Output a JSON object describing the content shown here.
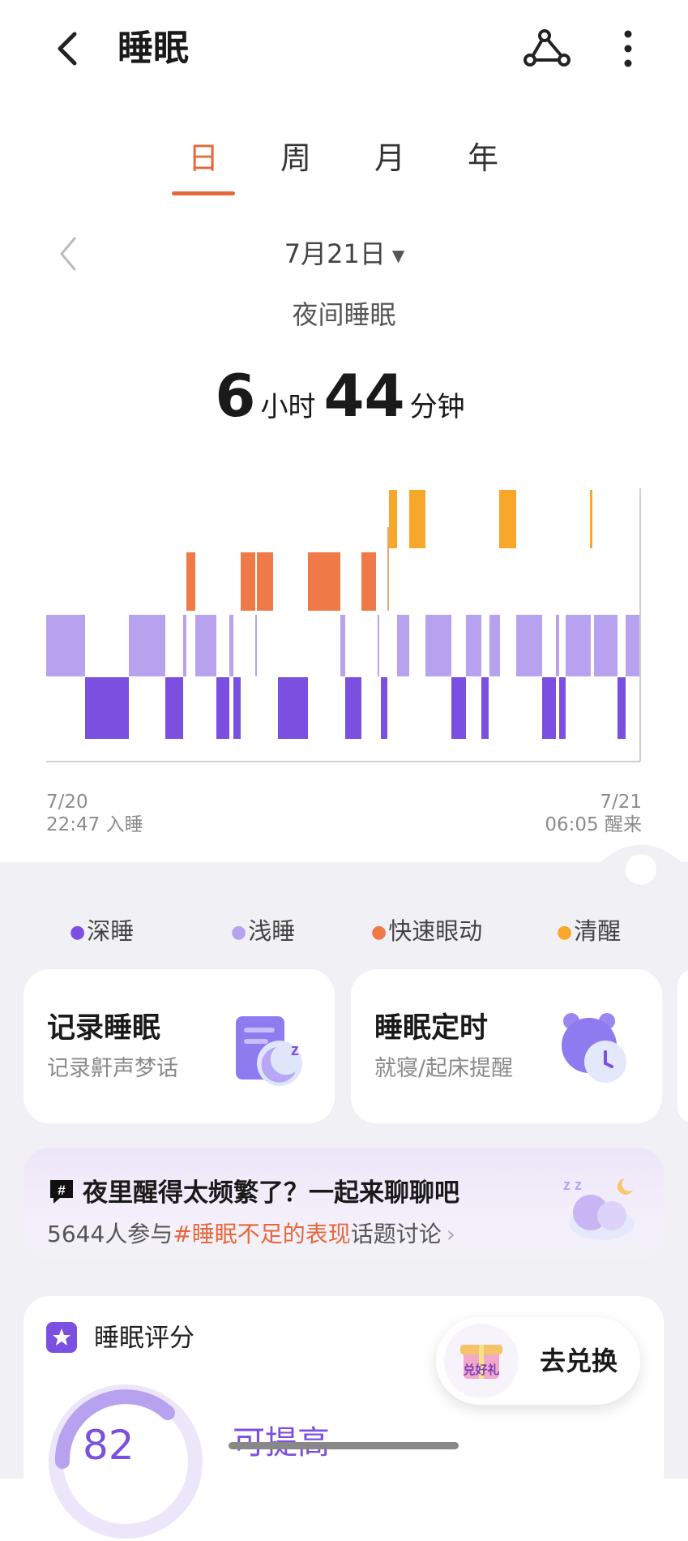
{
  "header": {
    "title": "睡眠"
  },
  "tabs": [
    "日",
    "周",
    "月",
    "年"
  ],
  "date": {
    "label": "7月21日"
  },
  "summary": {
    "section_label": "夜间睡眠",
    "hours": "6",
    "hours_unit": "小时",
    "minutes": "44",
    "minutes_unit": "分钟"
  },
  "timeline": {
    "start_date": "7/20",
    "start_time": "22:47 入睡",
    "end_date": "7/21",
    "end_time": "06:05 醒来"
  },
  "legend": [
    {
      "label": "深睡",
      "color": "#7b4fe0"
    },
    {
      "label": "浅睡",
      "color": "#b7a2f0"
    },
    {
      "label": "快速眼动",
      "color": "#f07a47"
    },
    {
      "label": "清醒",
      "color": "#f9a72b"
    }
  ],
  "cards": {
    "record": {
      "title": "记录睡眠",
      "subtitle": "记录鼾声梦话"
    },
    "timer": {
      "title": "睡眠定时",
      "subtitle": "就寝/起床提醒"
    }
  },
  "topic": {
    "title": "夜里醒得太频繁了？一起来聊聊吧",
    "count_text": "5644人参与",
    "hashtag": "#睡眠不足的表现",
    "suffix": "话题讨论"
  },
  "score": {
    "title": "睡眠评分",
    "value": "82",
    "status": "可提高",
    "exchange_label": "去兑换",
    "gift_text": "兑好礼"
  }
}
